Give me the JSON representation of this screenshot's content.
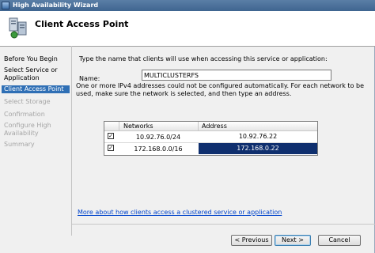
{
  "window": {
    "title": "High Availability Wizard"
  },
  "header": {
    "title": "Client Access Point"
  },
  "nav": {
    "items": [
      {
        "label": "Before You Begin",
        "state": "normal"
      },
      {
        "label": "Select Service or Application",
        "state": "normal"
      },
      {
        "label": "Client Access Point",
        "state": "selected"
      },
      {
        "label": "Select Storage",
        "state": "disabled"
      },
      {
        "label": "Confirmation",
        "state": "disabled"
      },
      {
        "label": "Configure High Availability",
        "state": "disabled"
      },
      {
        "label": "Summary",
        "state": "disabled"
      }
    ]
  },
  "content": {
    "instruction": "Type the name that clients will use when accessing this service or application:",
    "name_label": "Name:",
    "name_value": "MULTICLUSTERFS",
    "description": "One or more IPv4 addresses could not be configured automatically.  For each network to be used, make sure the network is selected, and then type an address.",
    "grid": {
      "columns": [
        "Networks",
        "Address"
      ],
      "rows": [
        {
          "checked": true,
          "network": "10.92.76.0/24",
          "address": "10.92.76.22",
          "selected": false
        },
        {
          "checked": true,
          "network": "172.168.0.0/16",
          "address": "172.168.0.22",
          "selected": true
        }
      ]
    },
    "link": "More about how clients access a clustered service or application"
  },
  "buttons": {
    "previous": "< Previous",
    "next": "Next >",
    "cancel": "Cancel"
  },
  "colors": {
    "selection": "#2f6fb5",
    "grid_selection": "#0f2f6e",
    "link": "#0044cc"
  }
}
